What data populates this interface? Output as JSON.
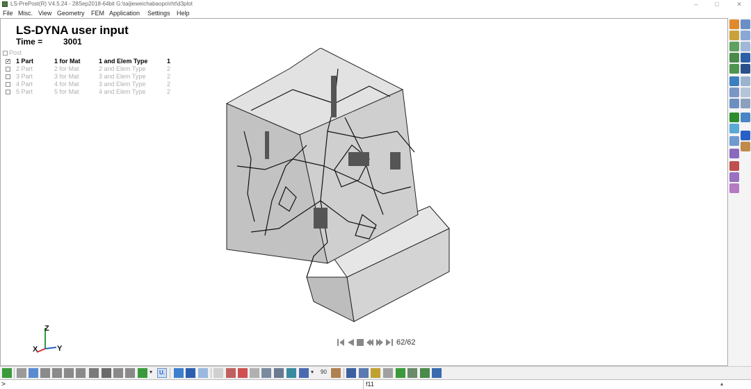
{
  "window": {
    "title": "LS-PrePost(R) V4.5.24 - 28Sep2018-64bit G:\\taijieweichabaopo\\rht\\d3plot",
    "controls": {
      "minimize": "–",
      "maximize": "□",
      "close": "✕"
    }
  },
  "menu": [
    "File",
    "Misc.",
    "View",
    "Geometry",
    "FEM",
    "Application",
    "Settings",
    "Help"
  ],
  "viewport": {
    "title": "LS-DYNA user input",
    "time_label": "Time =",
    "time_value": "3001"
  },
  "tree": {
    "root_label": "Post",
    "parts": [
      {
        "part": "1 Part",
        "mat": "1 for Mat",
        "elem": "1 and Elem Type",
        "type": "1",
        "active": true
      },
      {
        "part": "2 Part",
        "mat": "2 for Mat",
        "elem": "2 and Elem Type",
        "type": "2",
        "active": false
      },
      {
        "part": "3 Part",
        "mat": "3 for Mat",
        "elem": "3 and Elem Type",
        "type": "2",
        "active": false
      },
      {
        "part": "4 Part",
        "mat": "4 for Mat",
        "elem": "3 and Elem Type",
        "type": "2",
        "active": false
      },
      {
        "part": "5 Part",
        "mat": "5 for Mat",
        "elem": "4 and Elem Type",
        "type": "2",
        "active": false
      }
    ]
  },
  "axis": {
    "z": "Z",
    "x": "X",
    "y": "Y"
  },
  "animation": {
    "frame": "62/62"
  },
  "bottom_toolbar": {
    "angle_value": "90",
    "u_label": "U."
  },
  "command": {
    "prompt": ">",
    "input_value": "",
    "history": "f11"
  },
  "colors": {
    "accent_green": "#2e9a3a",
    "accent_blue": "#2860c8",
    "model_fill": "#c8c8c8",
    "model_edge": "#202020"
  }
}
